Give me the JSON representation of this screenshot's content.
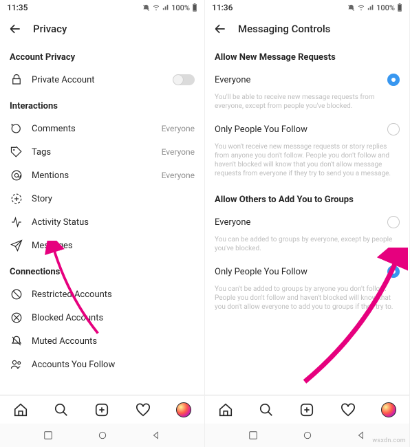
{
  "left": {
    "status": {
      "time": "11:35",
      "battery": "100%"
    },
    "appbar": {
      "title": "Privacy"
    },
    "section_account": "Account Privacy",
    "private_account": "Private Account",
    "section_interactions": "Interactions",
    "rows": {
      "comments": {
        "label": "Comments",
        "value": "Everyone"
      },
      "tags": {
        "label": "Tags",
        "value": "Everyone"
      },
      "mentions": {
        "label": "Mentions",
        "value": "Everyone"
      },
      "story": {
        "label": "Story"
      },
      "activity": {
        "label": "Activity Status"
      },
      "messages": {
        "label": "Messages"
      }
    },
    "section_connections": "Connections",
    "conn": {
      "restricted": "Restricted Accounts",
      "blocked": "Blocked Accounts",
      "muted": "Muted Accounts",
      "follow": "Accounts You Follow"
    }
  },
  "right": {
    "status": {
      "time": "11:36",
      "battery": "100%"
    },
    "appbar": {
      "title": "Messaging Controls"
    },
    "section_new": "Allow New Message Requests",
    "opt_everyone": "Everyone",
    "help_everyone": "You'll be able to receive new message requests from everyone, except from people you've blocked.",
    "opt_follow": "Only People You Follow",
    "help_follow": "You won't receive new message requests or story replies from anyone you don't follow. People you don't follow and haven't blocked will know that you don't allow message requests from everyone if they try to send you a message.",
    "section_groups": "Allow Others to Add You to Groups",
    "g_everyone": "Everyone",
    "g_help_everyone": "You can be added to groups by everyone, except by people you've blocked.",
    "g_follow": "Only People You Follow",
    "g_help_follow": "You can't be added to groups by anyone you don't follow. People you don't follow and haven't blocked will know that you don't allow everyone to add you to groups if they try to."
  },
  "watermark": "wsxdn.com"
}
